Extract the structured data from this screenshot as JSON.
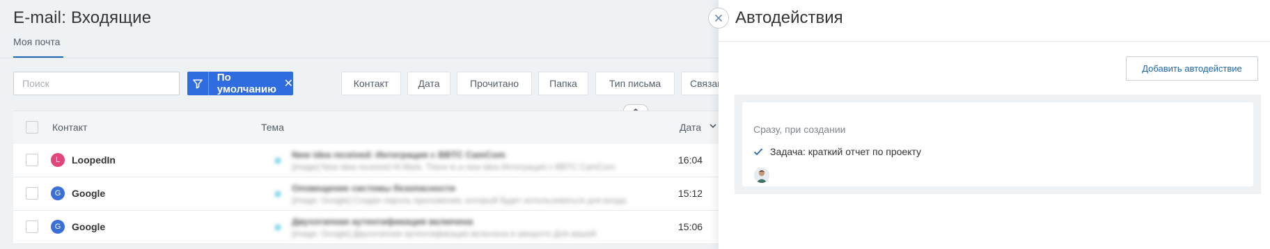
{
  "main": {
    "title": "E-mail: Входящие",
    "tab": "Моя почта",
    "search_placeholder": "Поиск",
    "preset": "По умолчанию",
    "filters": [
      "Контакт",
      "Дата",
      "Прочитано",
      "Папка",
      "Тип письма",
      "Связано со сд"
    ],
    "columns": {
      "contact": "Контакт",
      "subject": "Тема",
      "date": "Дата"
    },
    "rows": [
      {
        "avatar_letter": "L",
        "avatar_color": "#e0457b",
        "contact": "LoopedIn",
        "subject": "New idea received: Интеграция с BBTC CamCom",
        "preview": "[image] New idea received Hi Mark. There is a new idea Интеграция с BBTC CamCom",
        "time": "16:04"
      },
      {
        "avatar_letter": "G",
        "avatar_color": "#3b6fd8",
        "contact": "Google",
        "subject": "Оповещение системы безопасности",
        "preview": "[image: Google] Создан пароль приложения, который будет использоваться для входа",
        "time": "15:12"
      },
      {
        "avatar_letter": "G",
        "avatar_color": "#3b6fd8",
        "contact": "Google",
        "subject": "Двухэтапная аутентификация включена",
        "preview": "[image: Google] Двухэтапная аутентификация включена в аккаунте Для вашей",
        "time": "15:06"
      }
    ]
  },
  "panel": {
    "title": "Автодействия",
    "add_button": "Добавить автодействие",
    "condition": "Сразу, при создании",
    "task": "Задача: краткий отчет по проекту"
  },
  "colors": {
    "accent": "#2e6ce0",
    "link": "#2067b0",
    "check": "#2067b0"
  },
  "icons": [
    "close-icon",
    "filter-icon",
    "chevron-up-icon",
    "chevron-down-icon",
    "check-icon"
  ]
}
